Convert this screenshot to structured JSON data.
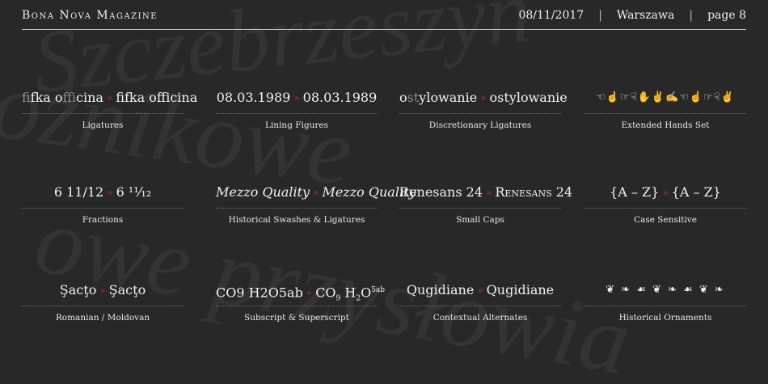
{
  "header": {
    "brand": "Bona Nova Magazine",
    "date": "08/11/2017",
    "city": "Warszawa",
    "page": "page 8"
  },
  "background_words": [
    "Szczebrzeszyn",
    "ożnikowe",
    "owe przysłowia"
  ],
  "features": [
    {
      "before_gray1": "fi",
      "before_a": "fk",
      "before_b": "a o",
      "before_gray2": "ffi",
      "before_c": "cina",
      "after": "fifka officina",
      "label": "Ligatures"
    },
    {
      "before": "08.03.1989",
      "after": "08.03.1989",
      "label": "Lining Figures"
    },
    {
      "before_a": "o",
      "before_gray": "st",
      "before_b": "ylowanie",
      "after": "ostylowanie",
      "label": "Discretionary Ligatures"
    },
    {
      "glyphs": "☜☝☞☟✋✌✍☜☝☞☟✌",
      "label": "Extended Hands Set"
    },
    {
      "before": "6 11/12",
      "after": "6 ¹¹⁄₁₂",
      "label": "Fractions"
    },
    {
      "before": "Mezzo Quality",
      "after": "Mezzo Quality",
      "label": "Historical Swashes & Ligatures"
    },
    {
      "before": "Renesans 24",
      "after": "Renesans 24",
      "label": "Small Caps"
    },
    {
      "before": "{A – Z}",
      "after": "{A – Z}",
      "label": "Case Sensitive"
    },
    {
      "before": "Şacţo",
      "after": "Şacţo",
      "label": "Romanian / Moldovan"
    },
    {
      "before": "CO9 H2O5ab",
      "after_co": "CO",
      "after_9": "9",
      "after_h": " H",
      "after_2": "2",
      "after_o": "O",
      "after_5ab": "5ab",
      "label": "Subscript & Superscript"
    },
    {
      "before": "Qugidiane",
      "after": "Qugidiane",
      "label": "Contextual Alternates"
    },
    {
      "glyphs": "❦ ❧ ☙ ❦ ❧ ☙ ❦ ❧",
      "label": "Historical Ornaments"
    }
  ],
  "arrow": "»"
}
